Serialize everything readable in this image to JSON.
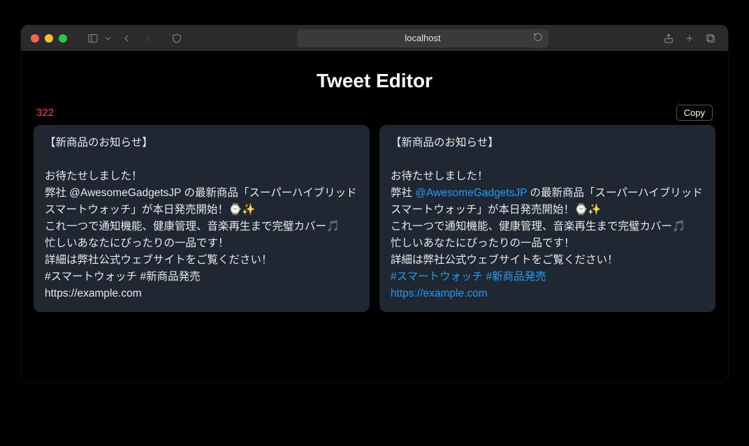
{
  "browser": {
    "address": "localhost"
  },
  "page": {
    "title": "Tweet Editor",
    "char_count": "322",
    "copy_label": "Copy"
  },
  "tweet": {
    "segments": [
      {
        "type": "text",
        "value": "【新商品のお知らせ】\n\nお待たせしました！\n弊社 "
      },
      {
        "type": "mention",
        "value": "@AwesomeGadgetsJP"
      },
      {
        "type": "text",
        "value": " の最新商品「スーパーハイブリッドスマートウォッチ」が本日発売開始！⌚✨\nこれ一つで通知機能、健康管理、音楽再生まで完璧カバー🎵\n忙しいあなたにぴったりの一品です！\n詳細は弊社公式ウェブサイトをご覧ください！\n"
      },
      {
        "type": "hashtag",
        "value": "#スマートウォッチ"
      },
      {
        "type": "text",
        "value": " "
      },
      {
        "type": "hashtag",
        "value": "#新商品発売"
      },
      {
        "type": "text",
        "value": "\n"
      },
      {
        "type": "link",
        "value": "https://example.com"
      }
    ],
    "plain": "【新商品のお知らせ】\n\nお待たせしました！\n弊社 @AwesomeGadgetsJP の最新商品「スーパーハイブリッドスマートウォッチ」が本日発売開始！⌚✨\nこれ一つで通知機能、健康管理、音楽再生まで完璧カバー🎵\n忙しいあなたにぴったりの一品です！\n詳細は弊社公式ウェブサイトをご覧ください！\n#スマートウォッチ #新商品発売\nhttps://example.com"
  }
}
